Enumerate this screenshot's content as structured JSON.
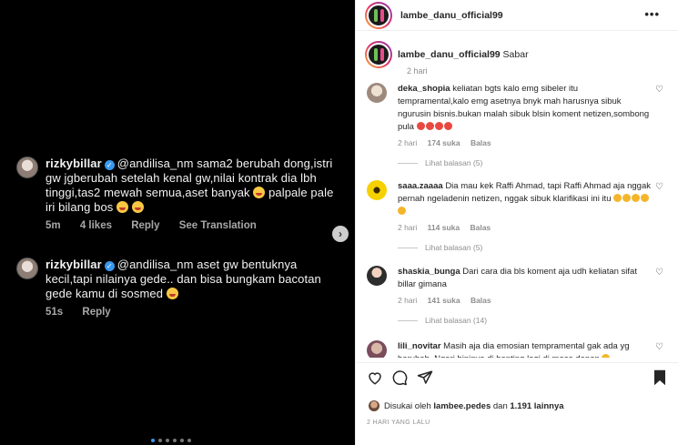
{
  "media": {
    "comments": [
      {
        "username": "rizkybillar",
        "text": "@andilisa_nm sama2 berubah dong,istri gw jgberubah setelah kenal gw,nilai kontrak dia lbh tinggi,tas2 mewah semua,aset banyak",
        "text_tail": "palpale pale iri bilang bos",
        "time": "5m",
        "likes": "4 likes",
        "reply": "Reply",
        "translation": "See Translation"
      },
      {
        "username": "rizkybillar",
        "text": "@andilisa_nm aset gw bentuknya kecil,tapi nilainya gede.. dan bisa bungkam bacotan gede kamu di sosmed",
        "time": "51s",
        "reply": "Reply"
      }
    ],
    "next_icon": "chevron-right-icon",
    "carousel_dots": 6
  },
  "post": {
    "username": "lambe_danu_official99",
    "more_icon": "more-horizontal-icon",
    "caption_text": "Sabar",
    "caption_time": "2 hari"
  },
  "comments": [
    {
      "username": "deka_shopia",
      "text": "keliatan bgts kalo emg sibeler itu tempramental,kalo emg asetnya bnyk mah harusnya sibuk ngurusin bisnis.bukan malah sibuk blsin koment netizen,sombong pula",
      "time": "2 hari",
      "likes": "174 suka",
      "reply": "Balas",
      "view_replies": "Lihat balasan (5)"
    },
    {
      "username": "saaa.zaaaa",
      "text": "Dia mau kek Raffi Ahmad, tapi Raffi Ahmad aja nggak pernah ngeladenin netizen, nggak sibuk klarifikasi ini itu",
      "time": "2 hari",
      "likes": "114 suka",
      "reply": "Balas",
      "view_replies": "Lihat balasan (5)"
    },
    {
      "username": "shaskia_bunga",
      "text": "Dari cara dia bls koment aja udh keliatan sifat billar gimana",
      "time": "2 hari",
      "likes": "141 suka",
      "reply": "Balas",
      "view_replies": "Lihat balasan (14)"
    },
    {
      "username": "lili_novitar",
      "text": "Masih aja dia emosian tempramental gak ada yg berubah. Ngeri bininya di banting lagi di masa depan"
    }
  ],
  "actions": {
    "like_icon": "heart-icon",
    "comment_icon": "comment-icon",
    "share_icon": "send-icon",
    "save_icon": "bookmark-icon"
  },
  "likes_summary": {
    "prefix": "Disukai oleh",
    "user": "lambee.pedes",
    "connector": "dan",
    "count": "1.191 lainnya"
  },
  "timestamp": "2 HARI YANG LALU"
}
